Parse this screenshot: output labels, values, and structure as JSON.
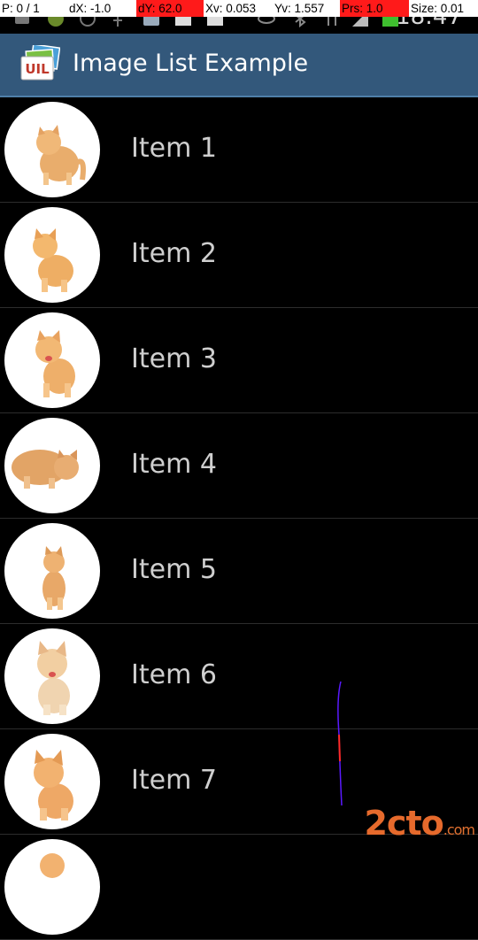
{
  "status_bar": {
    "pointer_readout": [
      "P: 0 / 1",
      "dX: -1.0",
      "dY: 62.0",
      "Xv: 0.053",
      "Yv: 1.557",
      "Prs: 1.0",
      "Size: 0.01"
    ],
    "time": "18:47"
  },
  "action_bar": {
    "title": "Image List Example",
    "app_icon": "uil-logo-icon",
    "app_icon_text": "UIL"
  },
  "list": {
    "items": [
      {
        "label": "Item 1",
        "thumbnail": "kitten-photo"
      },
      {
        "label": "Item 2",
        "thumbnail": "kitten-photo"
      },
      {
        "label": "Item 3",
        "thumbnail": "kitten-photo"
      },
      {
        "label": "Item 4",
        "thumbnail": "kitten-photo"
      },
      {
        "label": "Item 5",
        "thumbnail": "kitten-photo"
      },
      {
        "label": "Item 6",
        "thumbnail": "kitten-photo"
      },
      {
        "label": "Item 7",
        "thumbnail": "kitten-photo"
      }
    ]
  },
  "watermark": {
    "text": "2cto",
    "suffix": ".com"
  },
  "colors": {
    "action_bar": "#33587b",
    "list_background": "#000000",
    "item_text": "#cfcfcf",
    "highlight_red": "#ff1a1a"
  }
}
